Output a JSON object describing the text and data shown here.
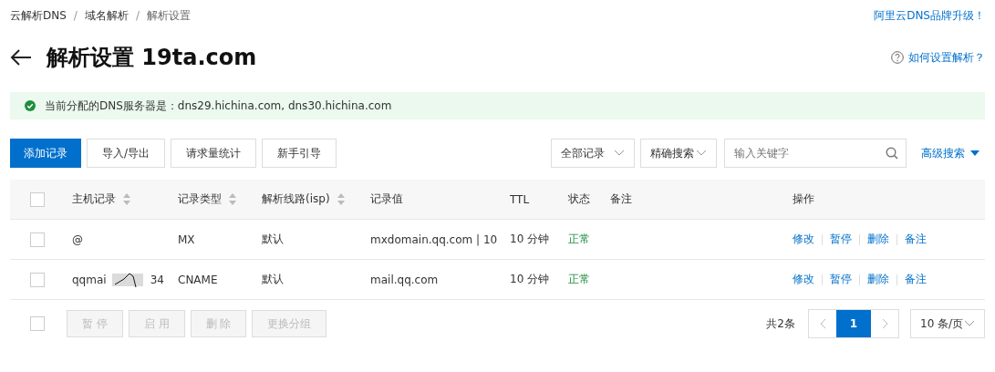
{
  "breadcrumb": [
    "云解析DNS",
    "域名解析",
    "解析设置"
  ],
  "breadcrumb_separator": "/",
  "top_link": "阿里云DNS品牌升级！",
  "title": "解析设置 19ta.com",
  "help_link": "如何设置解析？",
  "alert": {
    "kind": "success",
    "text": "当前分配的DNS服务器是：dns29.hichina.com, dns30.hichina.com"
  },
  "toolbar": {
    "buttons": [
      {
        "label": "添加记录",
        "primary": true
      },
      {
        "label": "导入/导出",
        "primary": false
      },
      {
        "label": "请求量统计",
        "primary": false
      },
      {
        "label": "新手引导",
        "primary": false
      }
    ],
    "filter": "全部记录",
    "search_mode": "精确搜索",
    "search": {
      "placeholder": "输入关键字"
    },
    "advanced": "高级搜索"
  },
  "table": {
    "header_checked": false,
    "columns": [
      {
        "label": "主机记录",
        "sortable": true
      },
      {
        "label": "记录类型",
        "sortable": true
      },
      {
        "label": "解析线路(isp)",
        "sortable": true
      },
      {
        "label": "记录值",
        "sortable": false
      },
      {
        "label": "TTL",
        "sortable": false
      },
      {
        "label": "状态",
        "sortable": false
      },
      {
        "label": "备注",
        "sortable": false
      },
      {
        "label": "操作",
        "sortable": false
      }
    ],
    "rows": [
      {
        "checked": false,
        "host": "@",
        "host_tail": "",
        "redacted": false,
        "type": "MX",
        "line": "默认",
        "value": "mxdomain.qq.com | 10",
        "ttl": "10 分钟",
        "status": "正常",
        "actions": [
          "修改",
          "暂停",
          "删除",
          "备注"
        ]
      },
      {
        "checked": false,
        "host": "qqmai",
        "host_tail": "34",
        "redacted": true,
        "type": "CNAME",
        "line": "默认",
        "value": "mail.qq.com",
        "ttl": "10 分钟",
        "status": "正常",
        "actions": [
          "修改",
          "暂停",
          "删除",
          "备注"
        ]
      }
    ]
  },
  "footer": {
    "checked": false,
    "buttons": [
      {
        "label": "暂 停",
        "disabled": true
      },
      {
        "label": "启 用",
        "disabled": true
      },
      {
        "label": "删 除",
        "disabled": true
      },
      {
        "label": "更换分组",
        "disabled": true
      }
    ],
    "total": "共2条",
    "pages": [
      {
        "label": "1",
        "selected": true
      }
    ],
    "page_size": "10 条/页"
  }
}
